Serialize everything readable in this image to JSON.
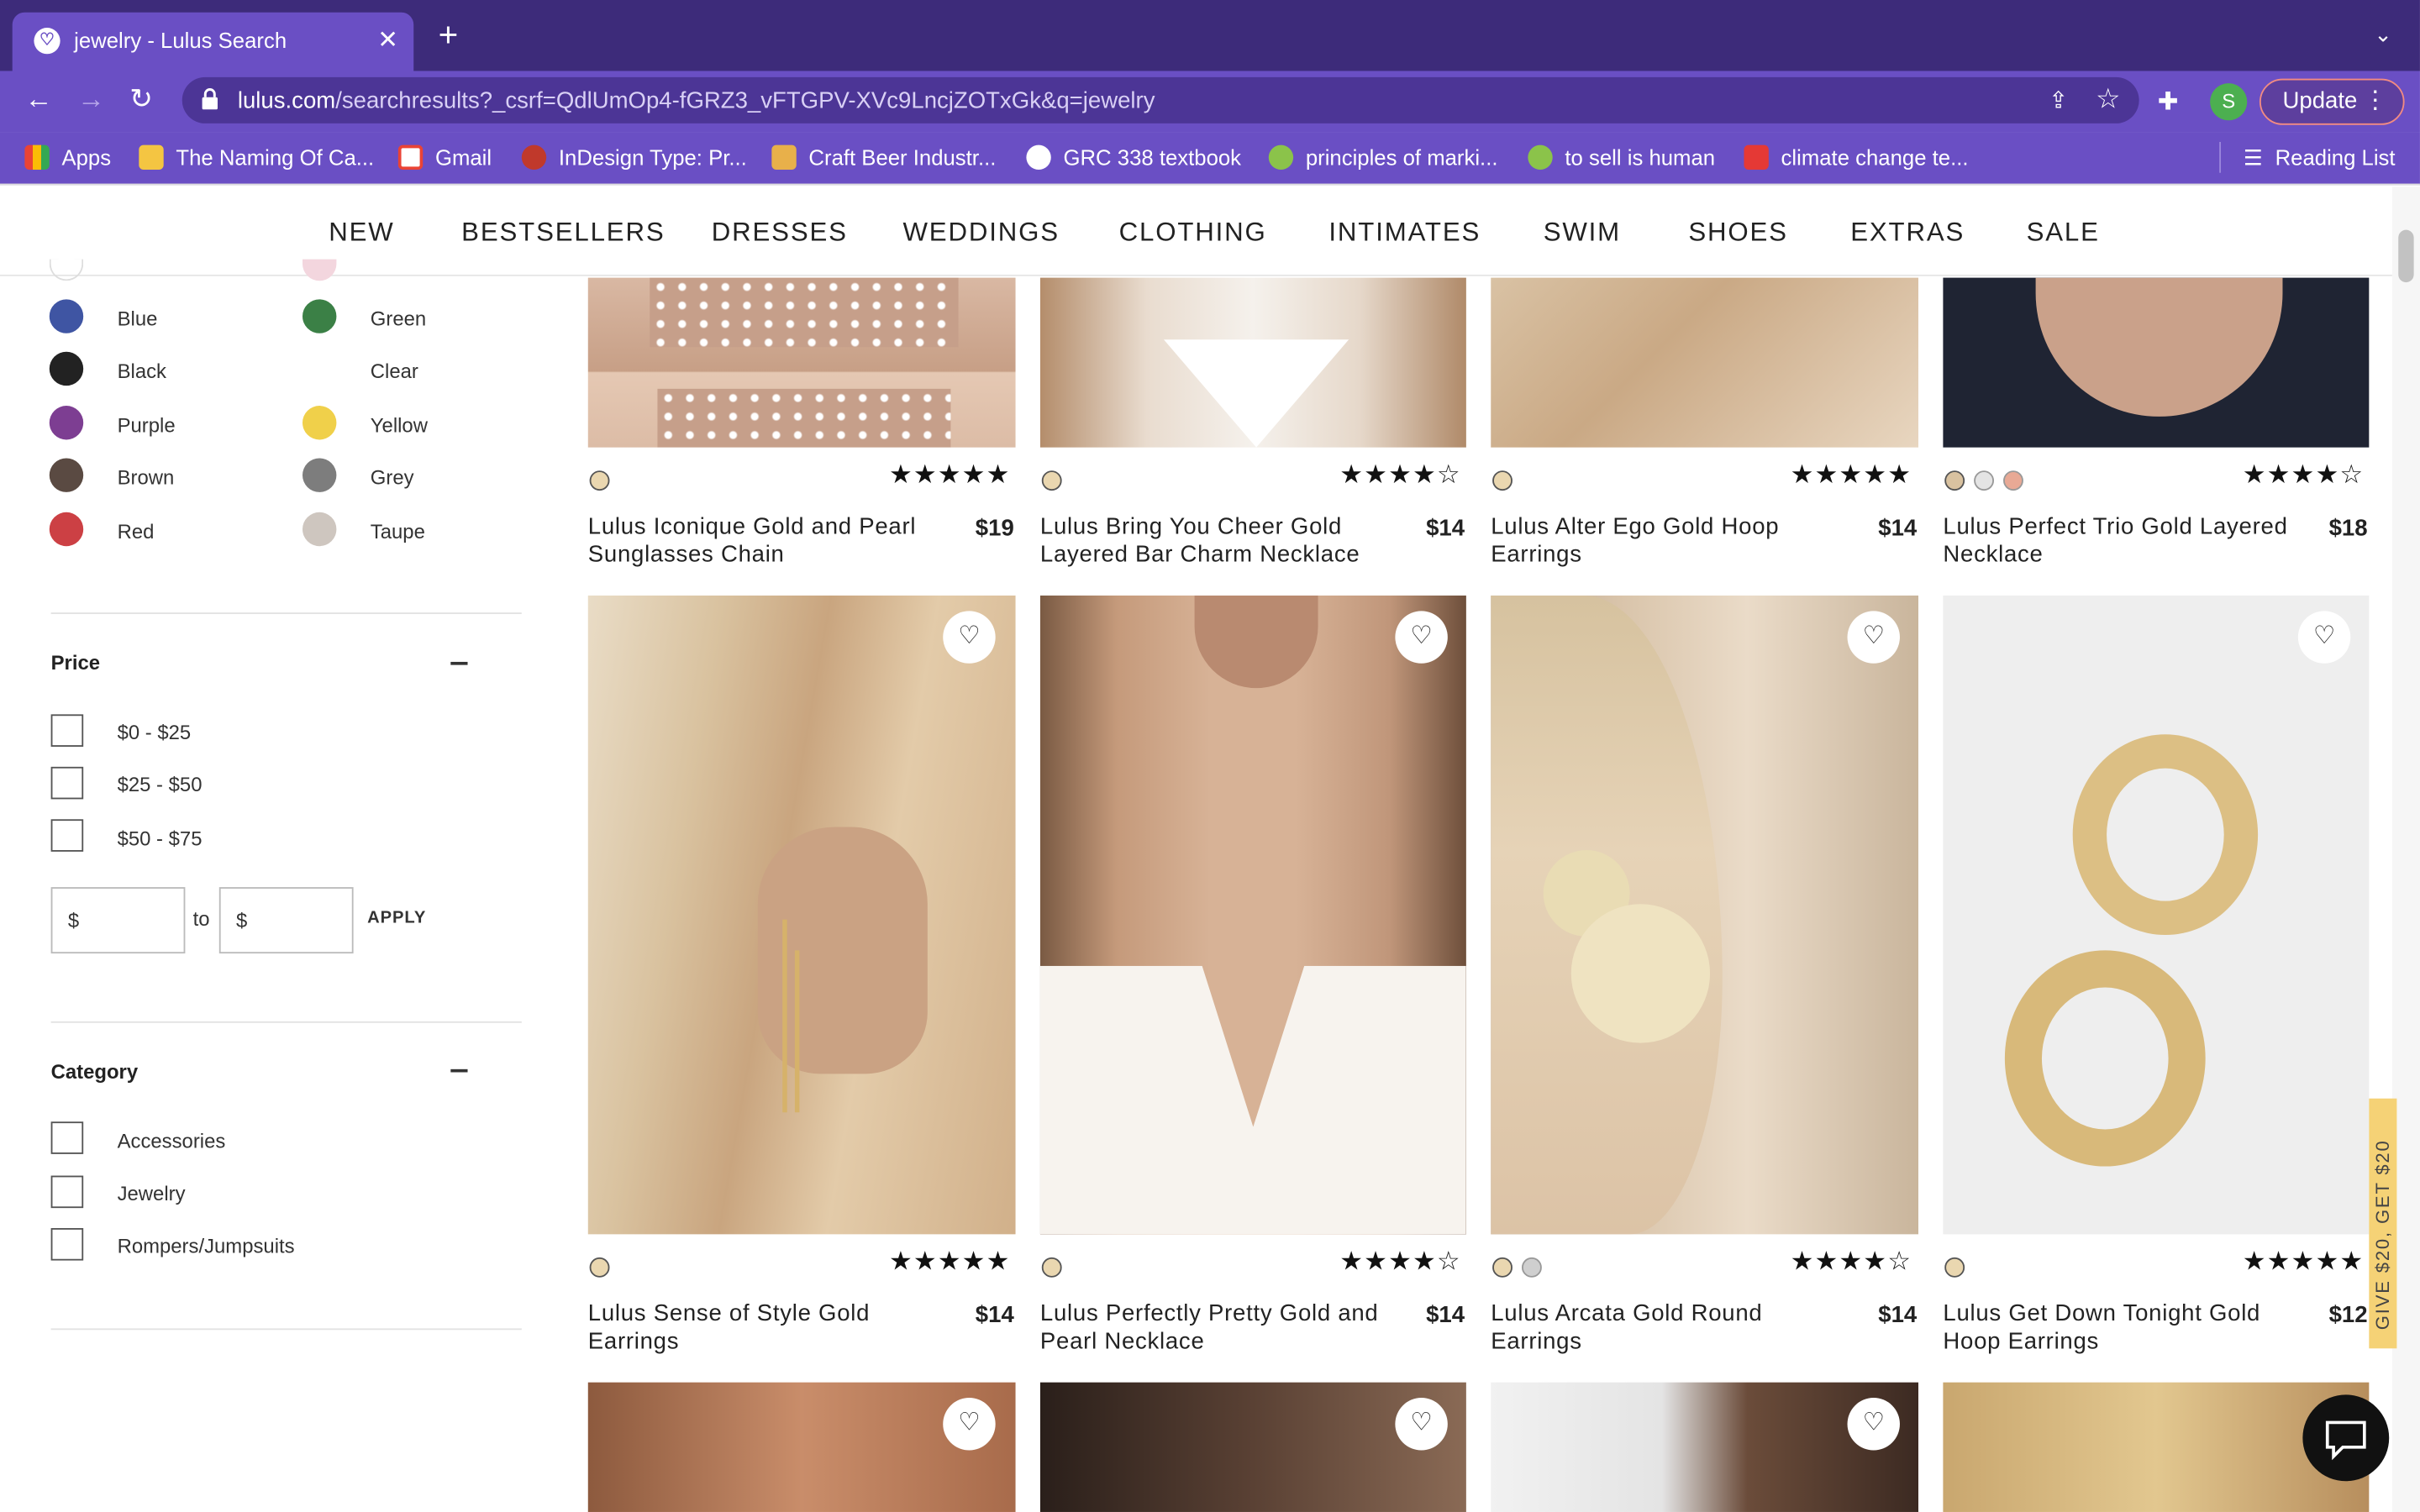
{
  "browser": {
    "tab_title": "jewelry - Lulus Search",
    "url_domain": "lulus.com",
    "url_path": "/searchresults?_csrf=QdlUmOp4-fGRZ3_vFTGPV-XVc9LncjZOTxGk&q=jewelry",
    "update_label": "Update",
    "profile_initial": "S",
    "bookmarks": [
      "Apps",
      "The Naming Of Ca...",
      "Gmail",
      "InDesign Type: Pr...",
      "Craft Beer Industr...",
      "GRC 338 textbook",
      "principles of marki...",
      "to sell is human",
      "climate change te..."
    ],
    "reading_list": "Reading List"
  },
  "nav": [
    "NEW",
    "BESTSELLERS",
    "DRESSES",
    "WEDDINGS",
    "CLOTHING",
    "INTIMATES",
    "SWIM",
    "SHOES",
    "EXTRAS",
    "SALE"
  ],
  "colors": [
    {
      "label": "Blue",
      "hex": "#3f55a3"
    },
    {
      "label": "Green",
      "hex": "#3b8046"
    },
    {
      "label": "Black",
      "hex": "#222222"
    },
    {
      "label": "Clear",
      "hex": "#ffffff"
    },
    {
      "label": "Purple",
      "hex": "#7d3e92"
    },
    {
      "label": "Yellow",
      "hex": "#f0d04a"
    },
    {
      "label": "Brown",
      "hex": "#5a4a42"
    },
    {
      "label": "Grey",
      "hex": "#7d7d7d"
    },
    {
      "label": "Red",
      "hex": "#cc4044"
    },
    {
      "label": "Taupe",
      "hex": "#cec6bf"
    }
  ],
  "price_filter": {
    "heading": "Price",
    "options": [
      "$0 - $25",
      "$25 - $50",
      "$50 - $75"
    ],
    "min_value": "$",
    "max_value": "$",
    "to_label": "to",
    "apply_label": "APPLY"
  },
  "category_filter": {
    "heading": "Category",
    "options": [
      "Accessories",
      "Jewelry",
      "Rompers/Jumpsuits"
    ]
  },
  "products": [
    {
      "name": "Lulus Iconique Gold and Pearl Sunglasses Chain",
      "price": "$19",
      "stars": "★★★★★",
      "rating": 5,
      "dots": [
        "#ead7b0"
      ]
    },
    {
      "name": "Lulus Bring You Cheer Gold Layered Bar Charm Necklace",
      "price": "$14",
      "stars": "★★★★☆",
      "rating": 4,
      "dots": [
        "#ead7b0"
      ]
    },
    {
      "name": "Lulus Alter Ego Gold Hoop Earrings",
      "price": "$14",
      "stars": "★★★★★",
      "rating": 4.5,
      "dots": [
        "#ead7b0"
      ]
    },
    {
      "name": "Lulus Perfect Trio Gold Layered Necklace",
      "price": "$18",
      "stars": "★★★★☆",
      "rating": 4.5,
      "dots": [
        "#d9c2a0",
        "#e4e4e4",
        "#e8a995"
      ]
    },
    {
      "name": "Lulus Sense of Style Gold Earrings",
      "price": "$14",
      "stars": "★★★★★",
      "rating": 4.5,
      "dots": [
        "#ead7b0"
      ]
    },
    {
      "name": "Lulus Perfectly Pretty Gold and Pearl Necklace",
      "price": "$14",
      "stars": "★★★★☆",
      "rating": 4,
      "dots": [
        "#ead7b0"
      ]
    },
    {
      "name": "Lulus Arcata Gold Round Earrings",
      "price": "$14",
      "stars": "★★★★☆",
      "rating": 3.5,
      "dots": [
        "#ead7b0",
        "#cfcfcf"
      ]
    },
    {
      "name": "Lulus Get Down Tonight Gold Hoop Earrings",
      "price": "$12",
      "stars": "★★★★★",
      "rating": 4.5,
      "dots": [
        "#ead7b0"
      ]
    }
  ],
  "promo_text": "GIVE $20, GET $20"
}
